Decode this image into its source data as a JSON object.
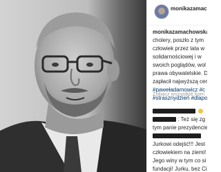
{
  "post": {
    "username": "monikazamachowska",
    "header_username_visible": "monikazamac",
    "caption": {
      "username": "monikazamachowska",
      "lines": [
        "cholery, poszło z tym",
        "człowiek przez lata w",
        "solidarnościowej i w",
        "swoich poglądów, wol",
        "prawa obywatelskie. D",
        "zapłacił najwyższą cen"
      ],
      "hashtags": [
        "#paweładamowicz #c",
        "#strasznydzień #dlapo"
      ]
    },
    "see_more_comments": "Zobacz wszystkie kom",
    "comments": [
      {
        "text": "",
        "has_emoji": true
      },
      {
        "text": ": Też się zg"
      },
      {
        "text": "tym panie prezydencie"
      },
      {
        "text": ""
      },
      {
        "text": "Jurkowi odejść!!! Jest"
      },
      {
        "text": "człowiekiem na ziemi!"
      },
      {
        "text": "Jego winy w tym co si"
      },
      {
        "text": "fundacji! Jurku, bez Ci"
      }
    ]
  },
  "colors": {
    "text": "#262626",
    "hashtag": "#003569",
    "muted": "#999999",
    "redaction": "#1e1e1e"
  },
  "icons": {
    "avatar": "profile-avatar",
    "heart": "heart-icon",
    "emoji": "smile-emoji-icon"
  }
}
